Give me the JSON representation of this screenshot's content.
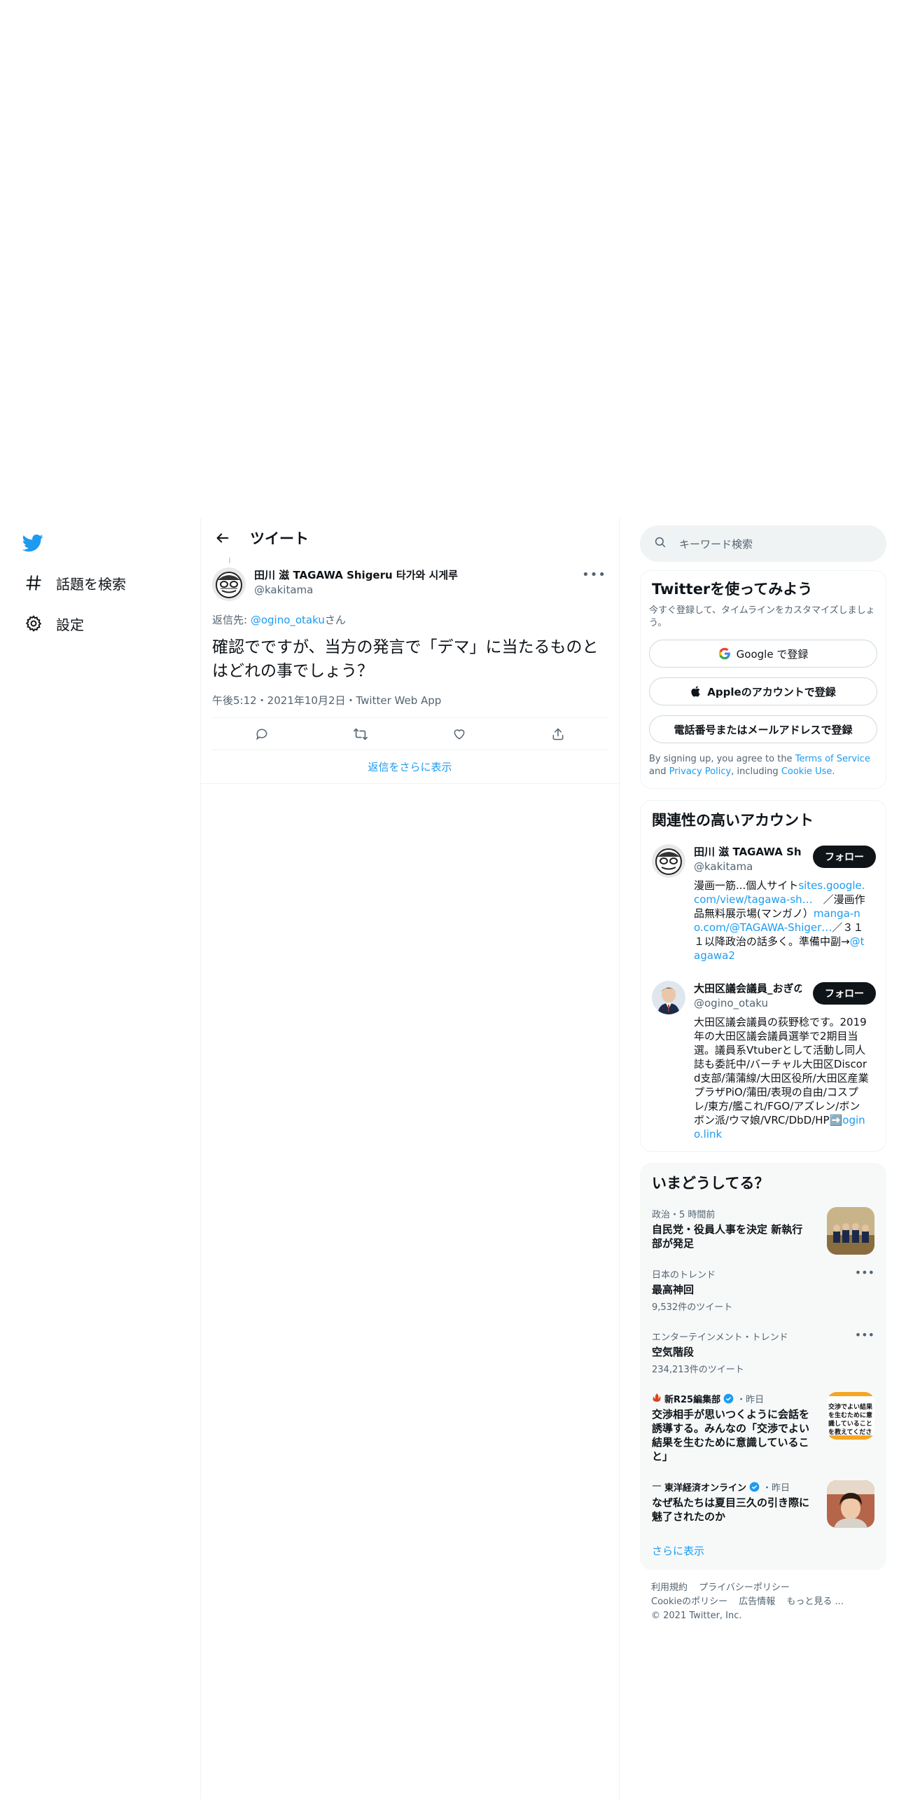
{
  "nav": {
    "explore_label": "話題を検索",
    "settings_label": "設定"
  },
  "header": {
    "title": "ツイート"
  },
  "tweet": {
    "display_name": "田川 滋 TAGAWA Shigeru 타가와 시게루",
    "handle": "@kakitama",
    "reply_prefix": "返信先: ",
    "reply_handle": "@ogino_otaku",
    "reply_suffix": "さん",
    "text": "確認でですが、当方の発言で「デマ」に当たるものとはどれの事でしょう？",
    "meta": "午後5:12・2021年10月2日・Twitter Web App",
    "more_replies": "返信をさらに表示"
  },
  "search": {
    "placeholder": "キーワード検索"
  },
  "signup": {
    "title": "Twitterを使ってみよう",
    "desc": "今すぐ登録して、タイムラインをカスタマイズしましょう。",
    "google_label": "Google で登録",
    "apple_label": "Appleのアカウントで登録",
    "phone_label": "電話番号またはメールアドレスで登録",
    "terms_1": "By signing up, you agree to the ",
    "terms_link1": "Terms of Service",
    "terms_2": " and ",
    "terms_link2": "Privacy Policy",
    "terms_3": ", including ",
    "terms_link3": "Cookie Use",
    "terms_4": "."
  },
  "related": {
    "title": "関連性の高いアカウント",
    "follow_label": "フォロー",
    "accounts": [
      {
        "name": "田川 滋 TAGAWA Shigeru 타가와 시게루",
        "handle": "@kakitama",
        "bio_1": "漫画一筋...個人サイト",
        "bio_link1": "sites.google.com/view/tagawa-sh…",
        "bio_2": "　／漫画作品無料展示場(マンガノ）",
        "bio_link2": "manga-no.com/@TAGAWA-Shiger…",
        "bio_3": "／３１１以降政治の話多く。準備中副→",
        "bio_link3": "@tagawa2"
      },
      {
        "name": "大田区議会議員_おぎの稔",
        "handle": "@ogino_otaku",
        "bio_1": "大田区議会議員の荻野稔です。2019年の大田区議会議員選挙で2期目当選。議員系Vtuberとして活動し同人誌も委託中/バーチャル大田区Discord支部/蒲蒲線/大田区役所/大田区産業プラザPiO/蒲田/表現の自由/コスプレ/東方/艦これ/FGO/アズレン/ボンボン派/ウマ娘/VRC/DbD/HP",
        "bio_emoji": "➡️",
        "bio_link1": "ogino.link"
      }
    ]
  },
  "trends": {
    "title": "いまどうしてる？",
    "items": [
      {
        "meta": "政治・5 時間前",
        "title": "自民党・役員人事を決定 新執行部が発足"
      },
      {
        "meta": "日本のトレンド",
        "title": "最高神回",
        "count": "9,532件のツイート"
      },
      {
        "meta": "エンターテインメント・トレンド",
        "title": "空気階段",
        "count": "234,213件のツイート"
      },
      {
        "source": "新R25編集部",
        "time": "・昨日",
        "title": "交渉相手が思いつくように会話を誘導する。みんなの「交渉でよい結果を生むために意識していること」",
        "thumb_text": "交渉でよい結果を生むために意識していることを教えてください"
      },
      {
        "source": "東洋経済オンライン",
        "time": "・昨日",
        "title": "なぜ私たちは夏目三久の引き際に魅了されたのか"
      }
    ],
    "show_more": "さらに表示"
  },
  "footer": {
    "terms": "利用規約",
    "privacy": "プライバシーポリシー",
    "cookie": "Cookieのポリシー",
    "ads": "広告情報",
    "more": "もっと見る ...",
    "copyright": "© 2021 Twitter, Inc."
  },
  "colors": {
    "accent": "#1d9bf0",
    "text": "#0f1419",
    "secondary": "#536471",
    "border": "#eff3f4"
  }
}
